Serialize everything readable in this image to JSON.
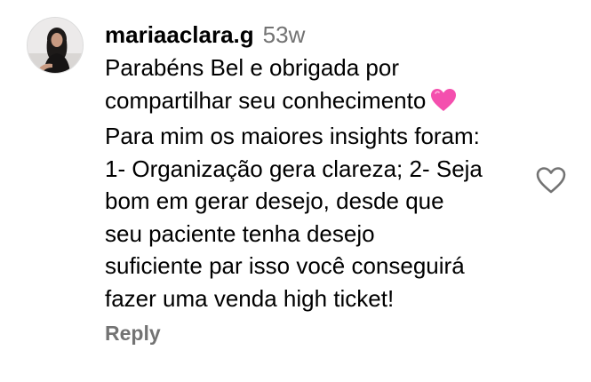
{
  "comment": {
    "username": "mariaaclara.g",
    "time": "53w",
    "lines": [
      "Parabéns Bel e obrigada por",
      "compartilhar seu conhecimento",
      "Para mim os maiores insights foram:",
      "1- Organização gera clareza; 2- Seja",
      "bom em gerar desejo, desde que",
      "seu paciente tenha desejo",
      "suficiente par isso você conseguirá",
      "fazer uma venda high ticket!"
    ],
    "emoji": "pink-heart",
    "reply_label": "Reply",
    "like_icon": "heart-outline-icon"
  },
  "colors": {
    "text": "#000000",
    "muted": "#737373",
    "emoji_pink": "#f44fae"
  }
}
